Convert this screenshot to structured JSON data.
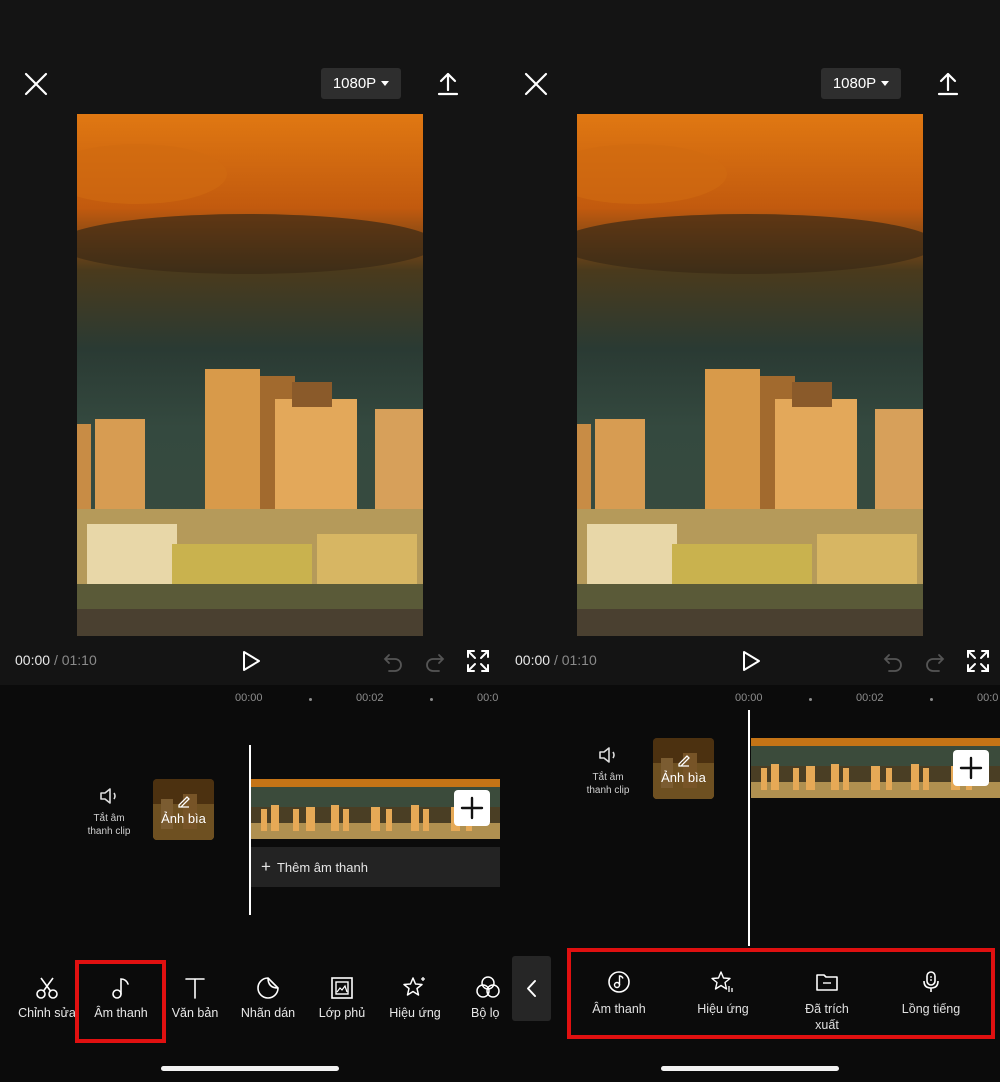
{
  "left_screen": {
    "resolution": "1080P",
    "time_current": "00:00",
    "time_separator": "/",
    "time_total": "01:10",
    "ruler_labels": [
      "00:00",
      "00:02",
      "00:0"
    ],
    "mute_label_line1": "Tắt âm",
    "mute_label_line2": "thanh clip",
    "cover_label": "Ảnh bìa",
    "add_audio_label": "Thêm âm thanh",
    "toolbar": [
      "Chỉnh sửa",
      "Âm thanh",
      "Văn bản",
      "Nhãn dán",
      "Lớp phủ",
      "Hiệu ứng",
      "Bộ lọ"
    ],
    "highlighted_tool": "Âm thanh"
  },
  "right_screen": {
    "resolution": "1080P",
    "time_current": "00:00",
    "time_separator": "/",
    "time_total": "01:10",
    "ruler_labels": [
      "00:00",
      "00:02",
      "00:0"
    ],
    "mute_label_line1": "Tắt âm",
    "mute_label_line2": "thanh clip",
    "cover_label": "Ảnh bìa",
    "audio_menu": [
      {
        "line1": "Âm thanh",
        "line2": "",
        "icon": "music-disc-icon"
      },
      {
        "line1": "Hiệu ứng",
        "line2": "",
        "icon": "sparkle-star-icon"
      },
      {
        "line1": "Đã trích",
        "line2": "xuất",
        "icon": "folder-icon"
      },
      {
        "line1": "Lồng tiếng",
        "line2": "",
        "icon": "microphone-icon"
      }
    ]
  },
  "colors": {
    "highlight": "#e01010",
    "background": "#0b0b0b",
    "panel": "#141414"
  }
}
